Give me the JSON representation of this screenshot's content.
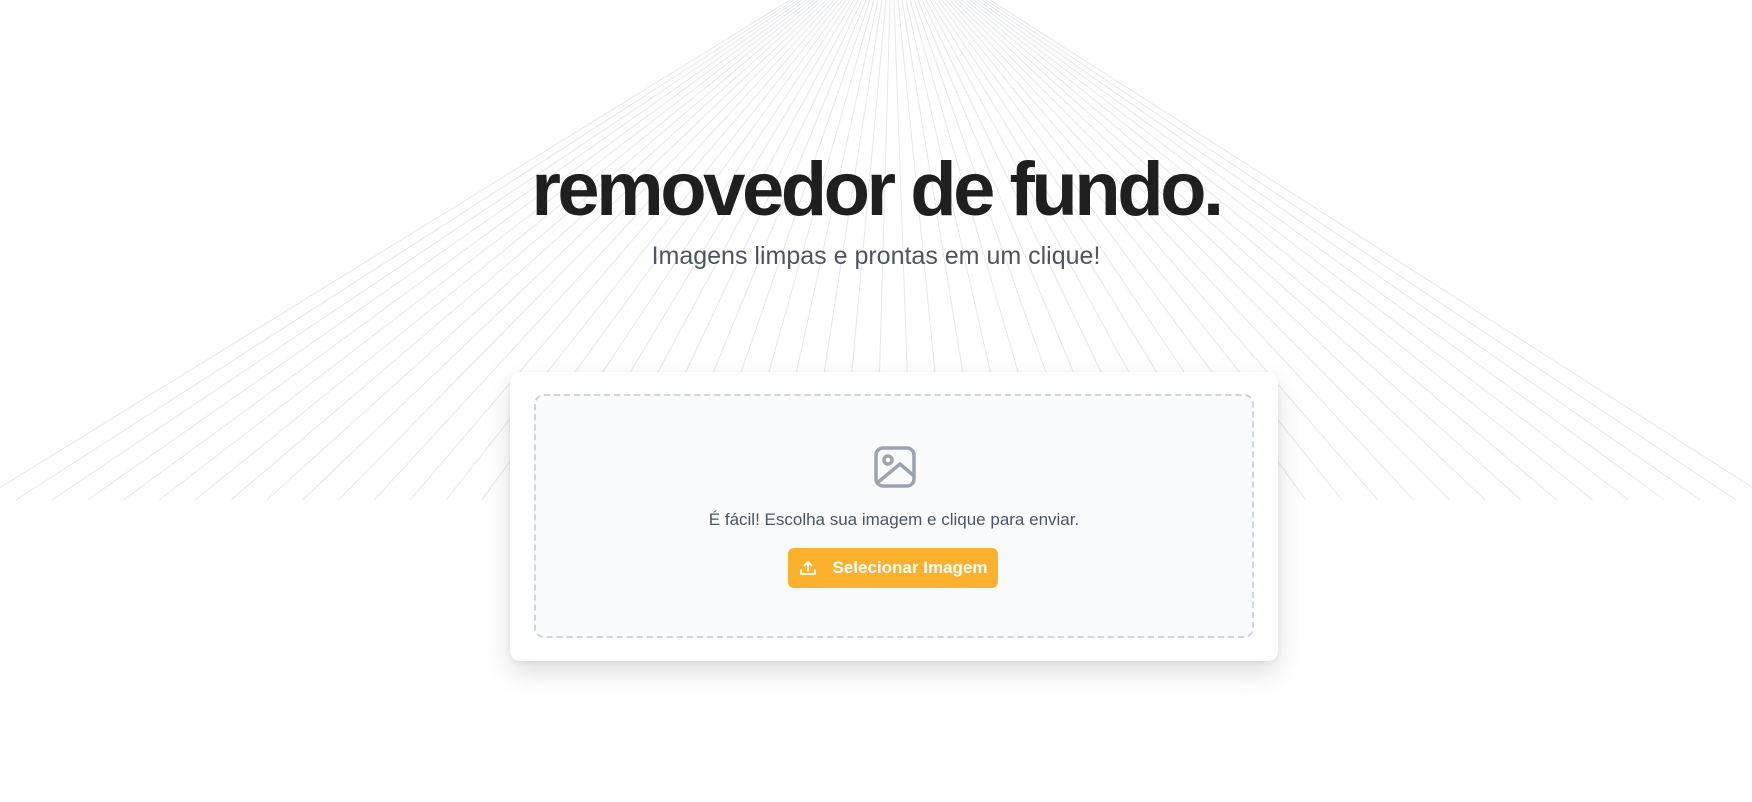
{
  "hero": {
    "title": "removedor de fundo.",
    "subtitle": "Imagens limpas e prontas em um clique!"
  },
  "upload": {
    "hint": "É fácil! Escolha sua imagem e clique para enviar.",
    "button_label": "Selecionar Imagem",
    "image_icon": "image-icon",
    "button_icon": "upload-icon"
  },
  "colors": {
    "accent": "#fbb12b",
    "title": "#1f1f1f",
    "subtitle": "#4b5563",
    "dropzone_border": "#d1d5db",
    "dropzone_bg": "#f9fafb",
    "rays": "#e5e7eb"
  }
}
